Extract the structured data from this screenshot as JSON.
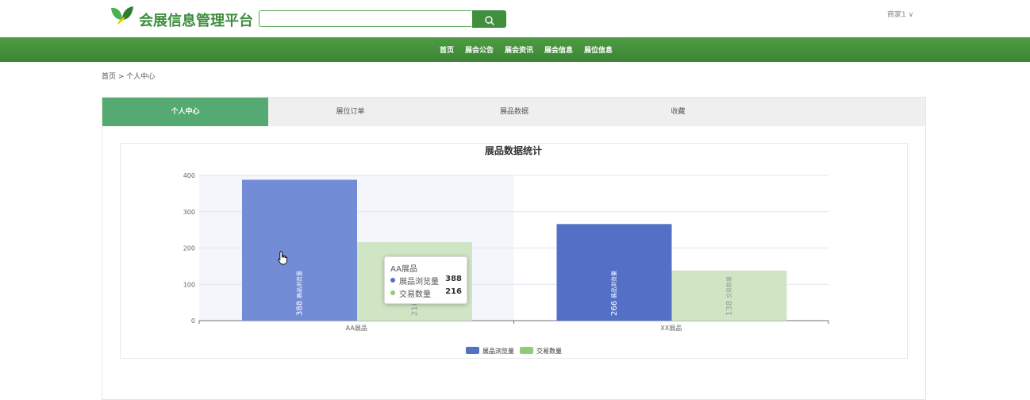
{
  "header": {
    "logo_text": "会展信息管理平台",
    "search_placeholder": "",
    "user_menu": "商家1 ∨"
  },
  "nav": {
    "items": [
      "首页",
      "展会公告",
      "展会资讯",
      "展会信息",
      "展位信息"
    ]
  },
  "breadcrumb": "首页 > 个人中心",
  "tabs": [
    {
      "label": "个人中心",
      "active": true
    },
    {
      "label": "展位订单",
      "active": false
    },
    {
      "label": "展品数据",
      "active": false
    },
    {
      "label": "收藏",
      "active": false
    }
  ],
  "colors": {
    "brand_green": "#3e8e3e",
    "nav_green": "#4a9640",
    "tab_active": "#55aa72",
    "series_views": "#5470c6",
    "series_trades": "#91cc75"
  },
  "chart_data": {
    "type": "bar",
    "title": "展品数据统计",
    "categories": [
      "AA展品",
      "XX展品"
    ],
    "series": [
      {
        "name": "展品浏览量",
        "values": [
          388,
          266
        ],
        "color": "#5470c6"
      },
      {
        "name": "交易数量",
        "values": [
          216,
          138
        ],
        "color": "#91cc75"
      }
    ],
    "yticks": [
      0,
      100,
      200,
      300,
      400
    ],
    "ylim": [
      0,
      400
    ],
    "legend_position": "bottom",
    "highlighted_category": "AA展品"
  },
  "tooltip": {
    "title": "AA展品",
    "rows": [
      {
        "name": "展品浏览量",
        "value": "388"
      },
      {
        "name": "交易数量",
        "value": "216"
      }
    ]
  }
}
